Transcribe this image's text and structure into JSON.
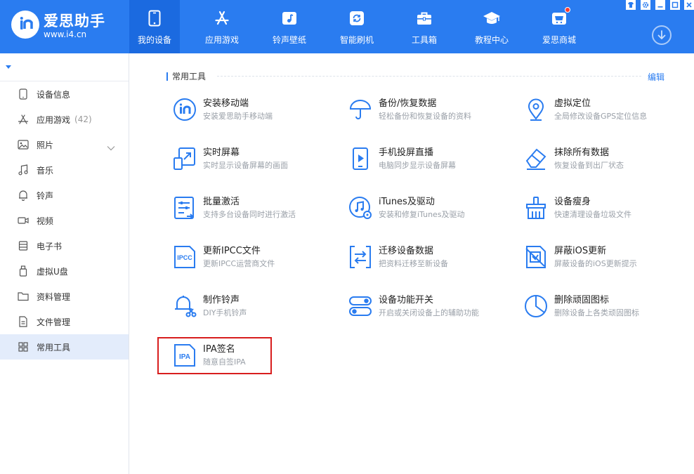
{
  "brand": {
    "name": "爱思助手",
    "url": "www.i4.cn"
  },
  "nav": [
    {
      "id": "my-device",
      "label": "我的设备",
      "icon": "phone-icon",
      "active": true
    },
    {
      "id": "apps-games",
      "label": "应用游戏",
      "icon": "app-store-icon",
      "active": false
    },
    {
      "id": "ringtones-wallpapers",
      "label": "铃声壁纸",
      "icon": "music-icon",
      "active": false
    },
    {
      "id": "smart-flash",
      "label": "智能刷机",
      "icon": "refresh-icon",
      "active": false
    },
    {
      "id": "toolbox",
      "label": "工具箱",
      "icon": "toolbox-icon",
      "active": false
    },
    {
      "id": "tutorials",
      "label": "教程中心",
      "icon": "graduation-cap-icon",
      "active": false
    },
    {
      "id": "store",
      "label": "爱思商城",
      "icon": "store-icon",
      "active": false,
      "badge": true
    }
  ],
  "sidebar": {
    "items": [
      {
        "id": "device-info",
        "label": "设备信息",
        "icon": "phone-outline-icon"
      },
      {
        "id": "apps",
        "label": "应用游戏",
        "count": "(42)",
        "icon": "app-icon"
      },
      {
        "id": "photos",
        "label": "照片",
        "icon": "image-icon",
        "expandable": true
      },
      {
        "id": "music",
        "label": "音乐",
        "icon": "music-note-icon"
      },
      {
        "id": "ringtones",
        "label": "铃声",
        "icon": "bell-icon"
      },
      {
        "id": "video",
        "label": "视频",
        "icon": "video-icon"
      },
      {
        "id": "ebooks",
        "label": "电子书",
        "icon": "book-icon"
      },
      {
        "id": "virtual-udisk",
        "label": "虚拟U盘",
        "icon": "usb-icon"
      },
      {
        "id": "data-manage",
        "label": "资料管理",
        "icon": "folder-icon"
      },
      {
        "id": "file-manage",
        "label": "文件管理",
        "icon": "file-icon"
      },
      {
        "id": "common-tools",
        "label": "常用工具",
        "icon": "grid-icon",
        "active": true
      }
    ]
  },
  "main": {
    "section_title": "常用工具",
    "edit_label": "编辑",
    "tools": [
      {
        "id": "install-mobile",
        "name": "安装移动端",
        "desc": "安装爱思助手移动端",
        "icon": "i4-logo-icon"
      },
      {
        "id": "backup-restore",
        "name": "备份/恢复数据",
        "desc": "轻松备份和恢复设备的资料",
        "icon": "umbrella-icon"
      },
      {
        "id": "virtual-location",
        "name": "虚拟定位",
        "desc": "全局修改设备GPS定位信息",
        "icon": "location-pin-icon"
      },
      {
        "id": "realtime-screen",
        "name": "实时屏幕",
        "desc": "实时显示设备屏幕的画面",
        "icon": "screen-mirror-icon"
      },
      {
        "id": "screen-cast",
        "name": "手机投屏直播",
        "desc": "电脑同步显示设备屏幕",
        "icon": "play-phone-icon"
      },
      {
        "id": "erase-all",
        "name": "抹除所有数据",
        "desc": "恢复设备到出厂状态",
        "icon": "eraser-icon"
      },
      {
        "id": "batch-activate",
        "name": "批量激活",
        "desc": "支持多台设备同时进行激活",
        "icon": "sliders-icon"
      },
      {
        "id": "itunes-driver",
        "name": "iTunes及驱动",
        "desc": "安装和修复iTunes及驱动",
        "icon": "itunes-icon"
      },
      {
        "id": "device-slim",
        "name": "设备瘦身",
        "desc": "快速清理设备垃圾文件",
        "icon": "broom-icon"
      },
      {
        "id": "update-ipcc",
        "name": "更新IPCC文件",
        "desc": "更新IPCC运营商文件",
        "icon": "ipcc-file-icon",
        "icon_text": "IPCC"
      },
      {
        "id": "migrate-data",
        "name": "迁移设备数据",
        "desc": "把资料迁移至新设备",
        "icon": "migrate-icon"
      },
      {
        "id": "block-ios-update",
        "name": "屏蔽iOS更新",
        "desc": "屏蔽设备的iOS更新提示",
        "icon": "block-update-icon"
      },
      {
        "id": "make-ringtone",
        "name": "制作铃声",
        "desc": "DIY手机铃声",
        "icon": "bell-scissors-icon"
      },
      {
        "id": "feature-toggles",
        "name": "设备功能开关",
        "desc": "开启或关闭设备上的辅助功能",
        "icon": "toggle-icon"
      },
      {
        "id": "remove-stubborn-icons",
        "name": "删除顽固图标",
        "desc": "删除设备上各类顽固图标",
        "icon": "pie-icon"
      },
      {
        "id": "ipa-sign",
        "name": "IPA签名",
        "desc": "随意自签IPA",
        "icon": "ipa-file-icon",
        "icon_text": "IPA",
        "highlighted": true
      }
    ]
  },
  "colors": {
    "primary": "#2a7cf0",
    "nav_active": "#1b6ae0",
    "sidebar_active": "#e3ecfb",
    "highlight": "#d81e1e"
  }
}
